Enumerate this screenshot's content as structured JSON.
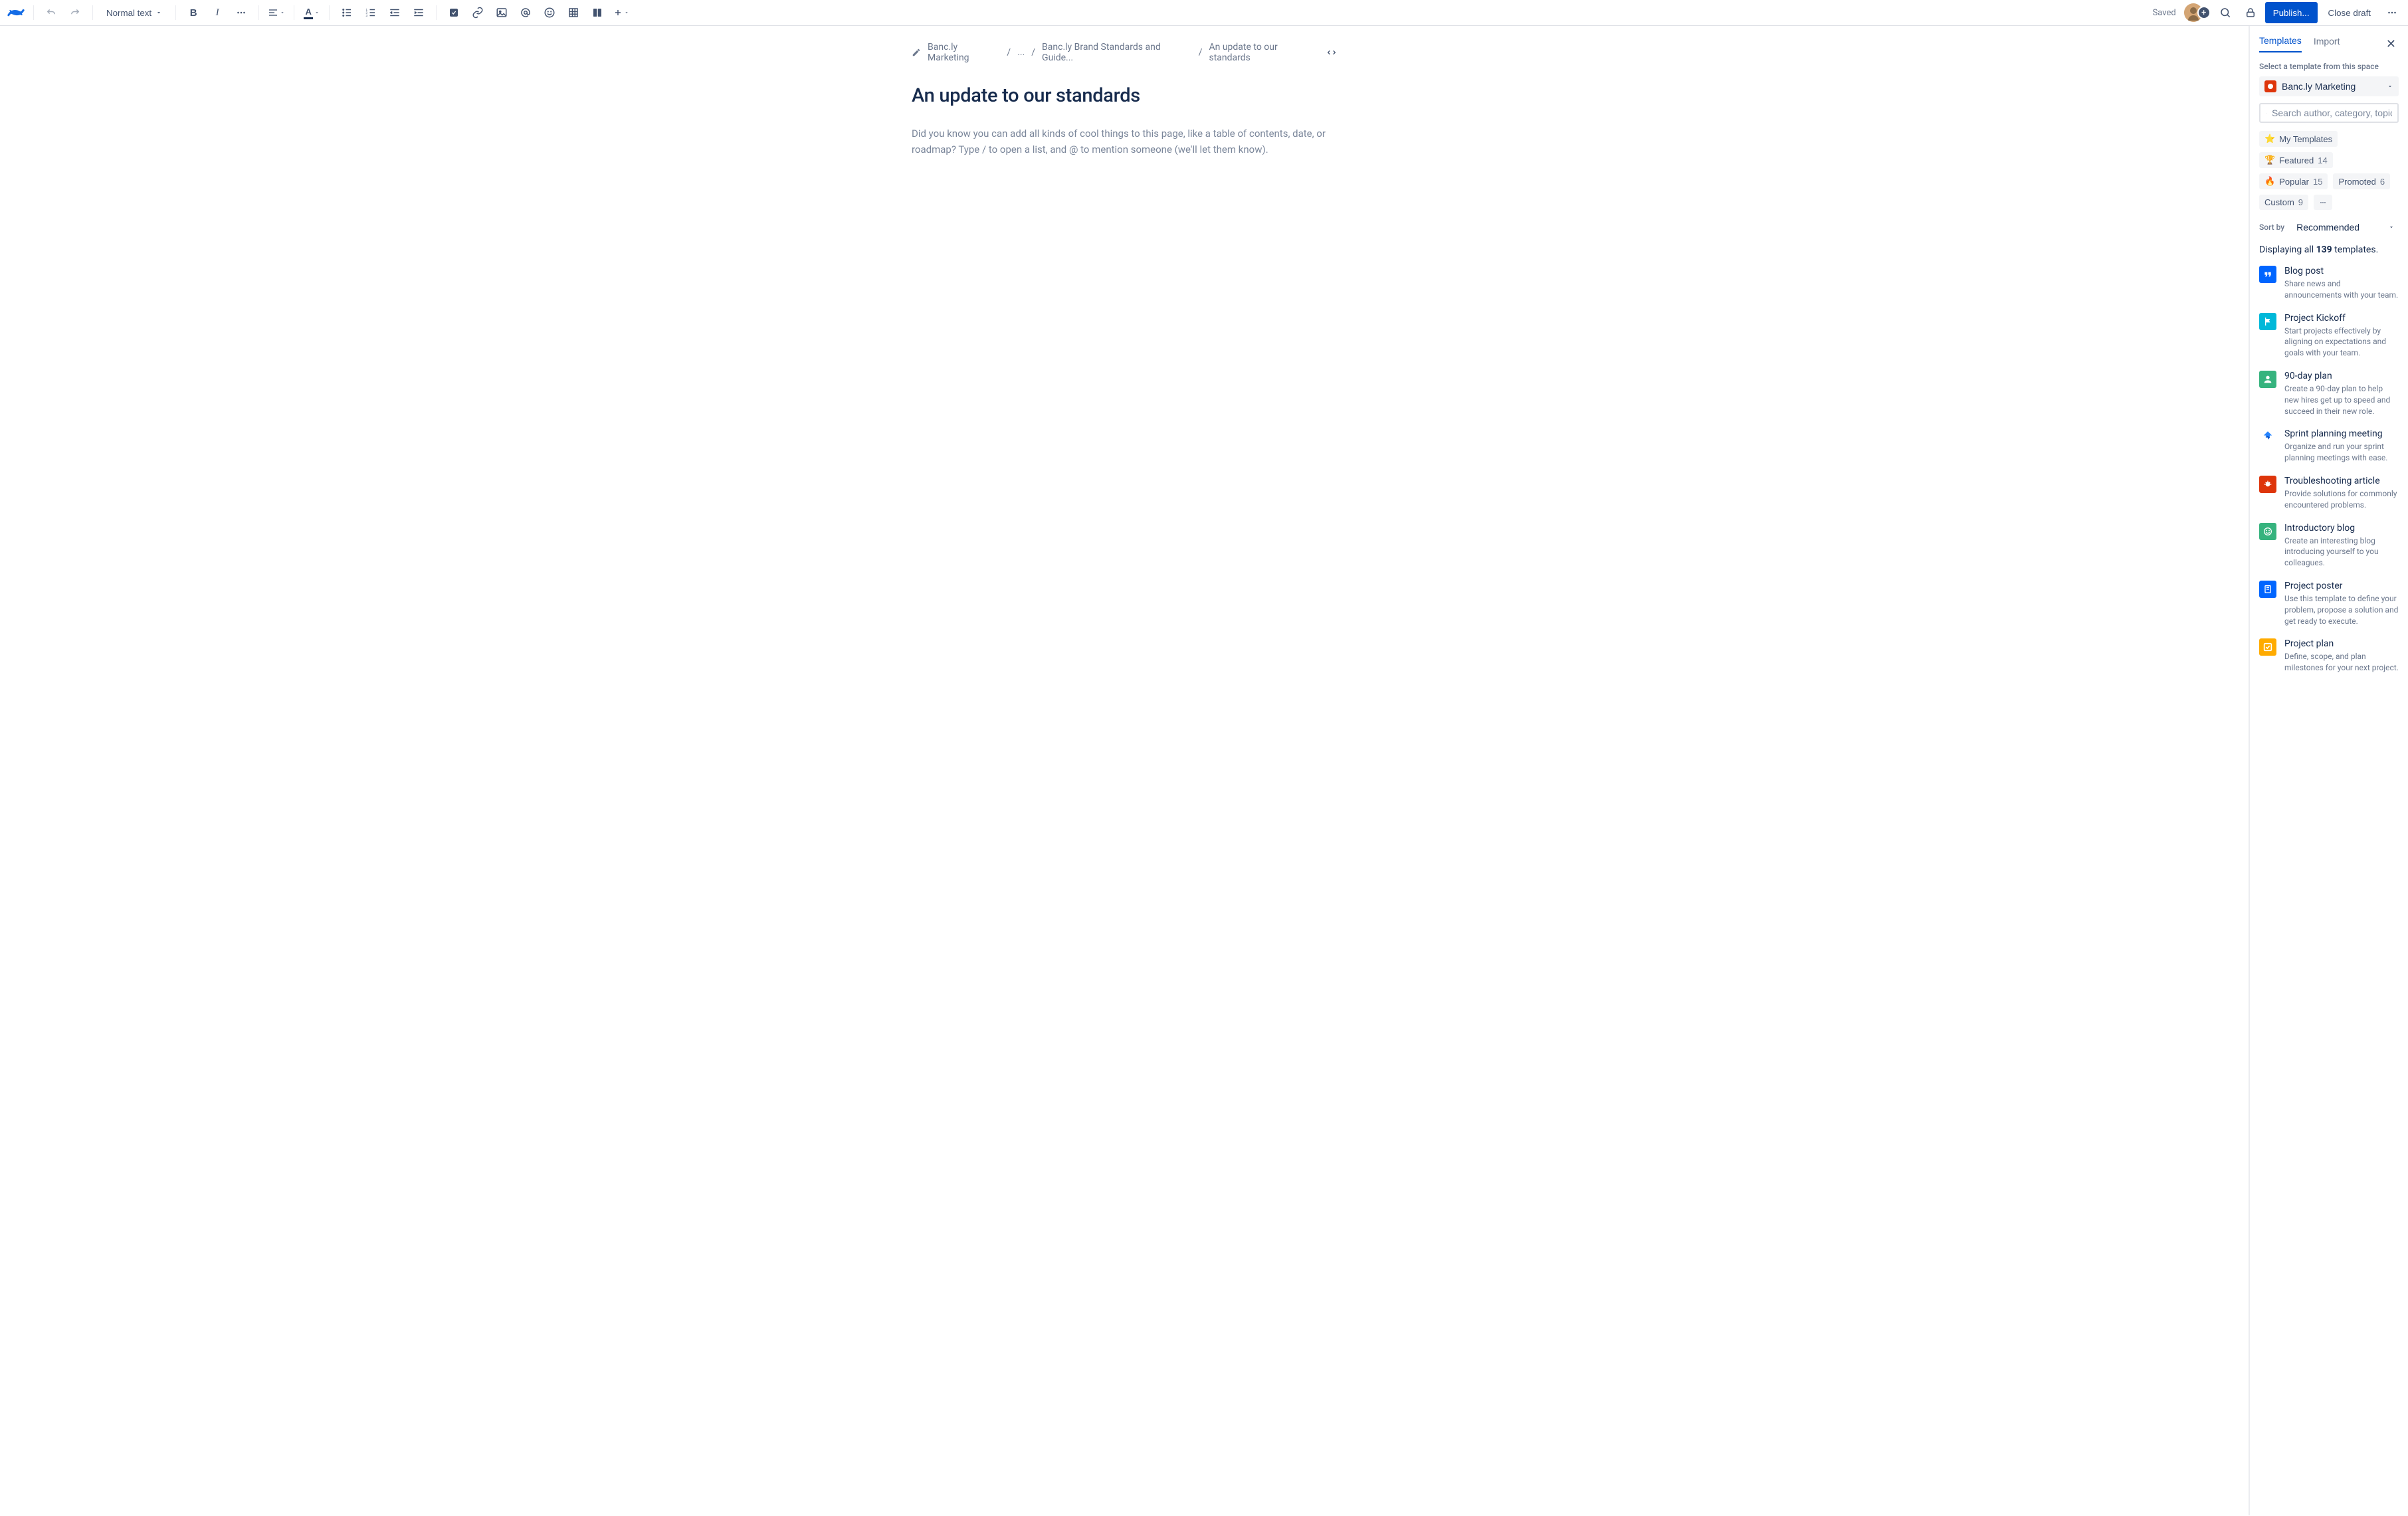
{
  "toolbar": {
    "text_style": "Normal text",
    "saved_label": "Saved",
    "publish_label": "Publish...",
    "close_draft_label": "Close draft"
  },
  "breadcrumb": {
    "items": [
      "Banc.ly Marketing",
      "...",
      "Banc.ly Brand Standards and Guide...",
      "An update to our standards"
    ]
  },
  "page": {
    "title": "An update to our standards",
    "placeholder": "Did you know you can add all kinds of cool things to this page, like a table of contents, date, or roadmap? Type / to open a list, and @ to mention someone (we'll let them know)."
  },
  "panel": {
    "tabs": {
      "templates": "Templates",
      "import": "Import"
    },
    "select_label": "Select a template from this space",
    "space_name": "Banc.ly Marketing",
    "search_placeholder": "Search author, category, topic",
    "chips": [
      {
        "icon": "⭐",
        "label": "My Templates",
        "count": ""
      },
      {
        "icon": "🏆",
        "label": "Featured",
        "count": "14"
      },
      {
        "icon": "🔥",
        "label": "Popular",
        "count": "15"
      },
      {
        "icon": "",
        "label": "Promoted",
        "count": "6"
      },
      {
        "icon": "",
        "label": "Custom",
        "count": "9"
      }
    ],
    "sort_label": "Sort by",
    "sort_value": "Recommended",
    "displaying_pre": "Displaying all ",
    "displaying_count": "139",
    "displaying_post": " templates.",
    "templates": [
      {
        "title": "Blog post",
        "desc": "Share news and announcements with your team.",
        "color": "#0065FF",
        "icon": "quote"
      },
      {
        "title": "Project Kickoff",
        "desc": "Start projects effectively by aligning on expectations and goals with your team.",
        "color": "#00B8D9",
        "icon": "flag"
      },
      {
        "title": "90-day plan",
        "desc": "Create a 90-day plan to help new hires get up to speed and succeed in their new role.",
        "color": "#36B37E",
        "icon": "user"
      },
      {
        "title": "Sprint planning meeting",
        "desc": "Organize and run your sprint planning meetings with ease.",
        "color": "#FFFFFF",
        "icon": "jira"
      },
      {
        "title": "Troubleshooting article",
        "desc": "Provide solutions for commonly encountered problems.",
        "color": "#DE350B",
        "icon": "bug"
      },
      {
        "title": "Introductory blog",
        "desc": "Create an interesting blog introducing yourself to you colleagues.",
        "color": "#36B37E",
        "icon": "smile"
      },
      {
        "title": "Project poster",
        "desc": "Use this template to define your problem, propose a solution and get ready to execute.",
        "color": "#0065FF",
        "icon": "poster"
      },
      {
        "title": "Project plan",
        "desc": "Define, scope, and plan milestones for your next project.",
        "color": "#FFAB00",
        "icon": "check"
      }
    ]
  }
}
